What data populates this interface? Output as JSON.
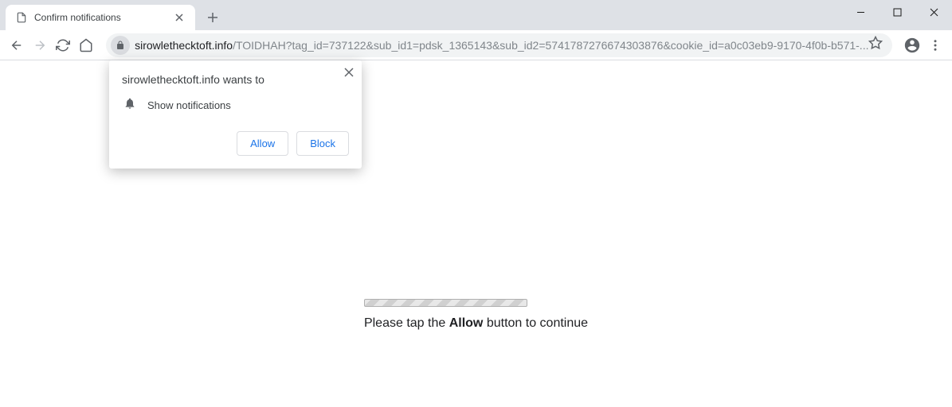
{
  "tab": {
    "title": "Confirm notifications"
  },
  "url": {
    "domain": "sirowlethecktoft.info",
    "path": "/TOIDHAH?tag_id=737122&sub_id1=pdsk_1365143&sub_id2=5741787276674303876&cookie_id=a0c03eb9-9170-4f0b-b571-..."
  },
  "permission": {
    "origin_wants_to": "sirowlethecktoft.info wants to",
    "request": "Show notifications",
    "allow": "Allow",
    "block": "Block"
  },
  "page": {
    "hint_pre": "Please tap the ",
    "hint_bold": "Allow",
    "hint_post": " button to continue"
  }
}
